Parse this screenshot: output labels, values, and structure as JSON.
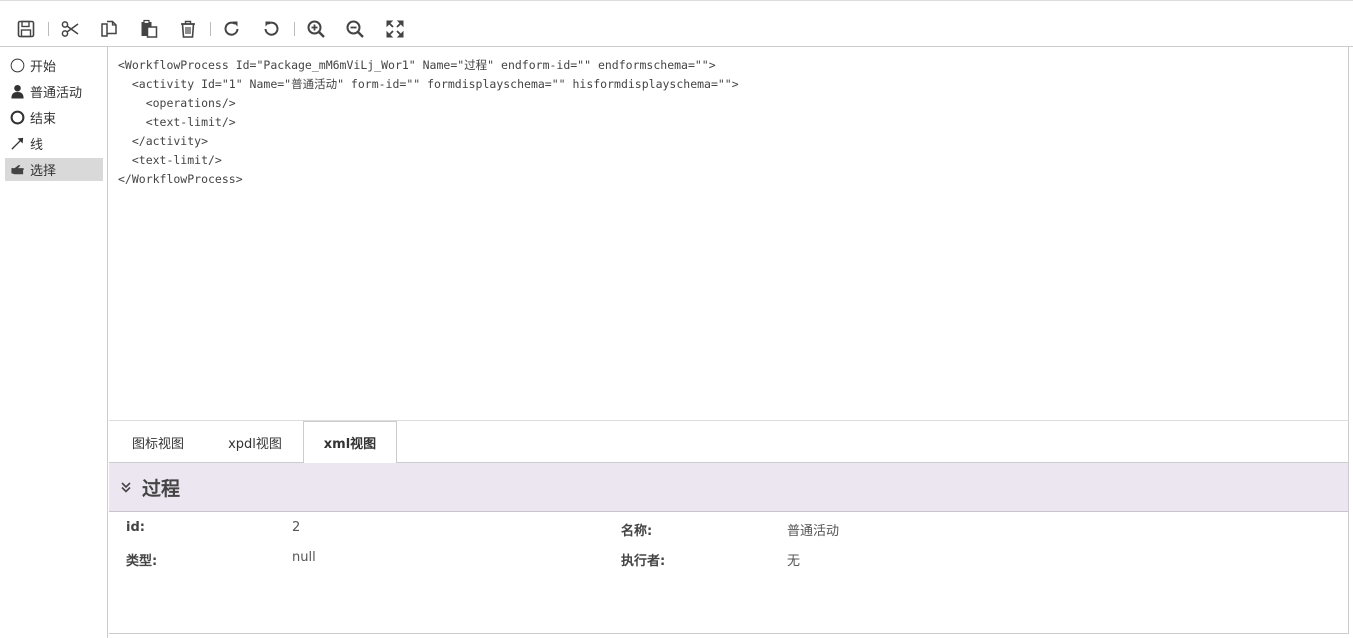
{
  "toolbar": {
    "buttons": [
      "save-icon",
      "cut-icon",
      "copy-icon",
      "paste-icon",
      "delete-icon",
      "redo-icon",
      "undo-icon",
      "zoom-in-icon",
      "zoom-out-icon",
      "fit-screen-icon"
    ]
  },
  "palette": {
    "items": [
      {
        "label": "开始",
        "icon": "start-circle-icon"
      },
      {
        "label": "普通活动",
        "icon": "user-icon"
      },
      {
        "label": "结束",
        "icon": "end-circle-icon"
      },
      {
        "label": "线",
        "icon": "arrow-line-icon"
      },
      {
        "label": "选择",
        "icon": "hand-pointer-icon",
        "active": true
      }
    ]
  },
  "xml": {
    "lines": [
      "<WorkflowProcess Id=\"Package_mM6mViLj_Wor1\" Name=\"过程\" endform-id=\"\" endformschema=\"\">",
      "  <activity Id=\"1\" Name=\"普通活动\" form-id=\"\" formdisplayschema=\"\" hisformdisplayschema=\"\">",
      "    <operations/>",
      "    <text-limit/>",
      "  </activity>",
      "  <text-limit/>",
      "</WorkflowProcess>"
    ]
  },
  "tabs": [
    {
      "label": "图标视图"
    },
    {
      "label": "xpdl视图"
    },
    {
      "label": "xml视图",
      "active": true
    }
  ],
  "panel": {
    "title": "过程",
    "props": {
      "id_label": "id:",
      "id_value": "2",
      "name_label": "名称:",
      "name_value": "普通活动",
      "type_label": "类型:",
      "type_value": "null",
      "executor_label": "执行者:",
      "executor_value": "无"
    }
  }
}
